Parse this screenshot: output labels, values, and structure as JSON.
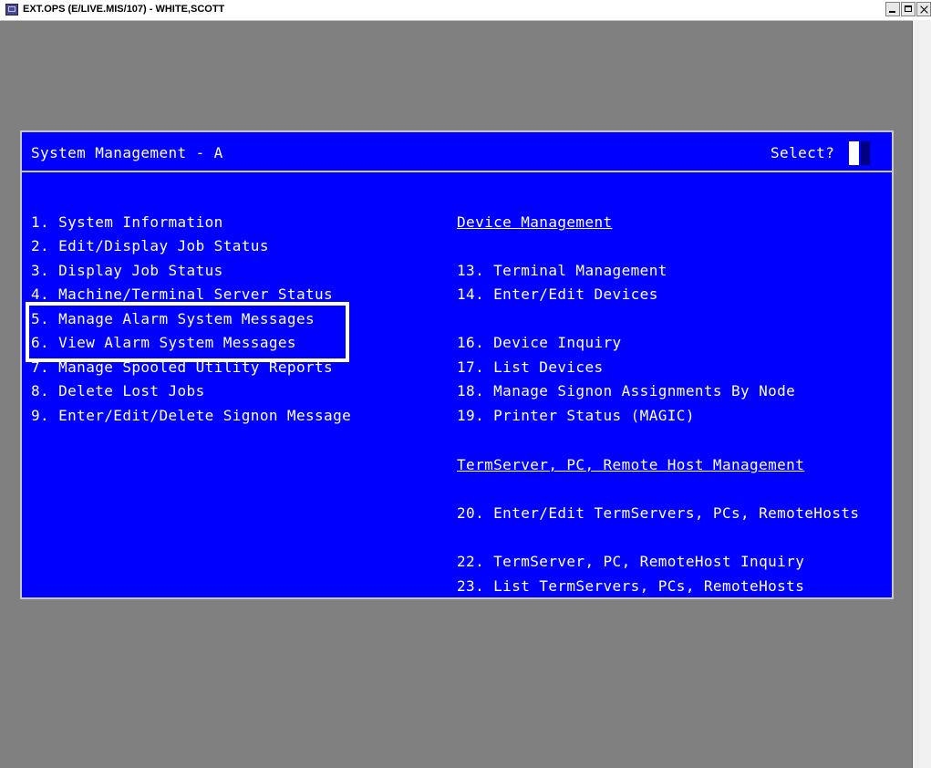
{
  "window": {
    "title": "EXT.OPS (E/LIVE.MIS/107) - WHITE,SCOTT"
  },
  "screen": {
    "title": "System Management - A",
    "prompt": "Select?"
  },
  "left_menu": [
    {
      "label": "1. System Information"
    },
    {
      "label": "2. Edit/Display Job Status"
    },
    {
      "label": "3. Display Job Status"
    },
    {
      "label": "4. Machine/Terminal Server Status"
    },
    {
      "label": "5. Manage Alarm System Messages"
    },
    {
      "label": "6. View Alarm System Messages"
    },
    {
      "label": "7. Manage Spooled Utility Reports"
    },
    {
      "label": "8. Delete Lost Jobs"
    },
    {
      "label": "9. Enter/Edit/Delete Signon Message"
    }
  ],
  "device_management": {
    "heading": "Device Management",
    "items": [
      {
        "label": "13. Terminal Management"
      },
      {
        "label": "14. Enter/Edit Devices"
      },
      {
        "label": "16. Device Inquiry"
      },
      {
        "label": "17. List Devices"
      },
      {
        "label": "18. Manage Signon Assignments By Node"
      },
      {
        "label": "19. Printer Status (MAGIC)"
      }
    ]
  },
  "termserver_management": {
    "heading": "TermServer, PC, Remote Host Management",
    "items": [
      {
        "label": "20. Enter/Edit TermServers, PCs, RemoteHosts"
      },
      {
        "label": "22. TermServer, PC, RemoteHost Inquiry"
      },
      {
        "label": "23. List TermServers, PCs, RemoteHosts"
      }
    ]
  },
  "colors": {
    "screen_background": "#0000ff",
    "text": "#ffffff",
    "desktop": "#808080"
  }
}
